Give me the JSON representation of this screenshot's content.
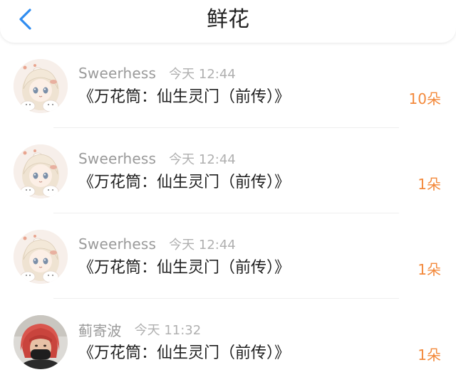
{
  "header": {
    "back_icon": "chevron-left-icon",
    "title": "鲜花",
    "accent_color": "#2f8cf0"
  },
  "flower_color": "#f3893b",
  "records": [
    {
      "avatar": "anime-girl-avatar",
      "name": "Sweerhess",
      "time": "今天 12:44",
      "work": "《万花筒：仙生灵门（前传）》",
      "flowers": "10朵"
    },
    {
      "avatar": "anime-girl-avatar",
      "name": "Sweerhess",
      "time": "今天 12:44",
      "work": "《万花筒：仙生灵门（前传）》",
      "flowers": "1朵"
    },
    {
      "avatar": "anime-girl-avatar",
      "name": "Sweerhess",
      "time": "今天 12:44",
      "work": "《万花筒：仙生灵门（前传）》",
      "flowers": "1朵"
    },
    {
      "avatar": "red-hair-person-avatar",
      "name": "蓟寄波",
      "time": "今天 11:32",
      "work": "《万花筒：仙生灵门（前传）》",
      "flowers": "1朵"
    }
  ]
}
